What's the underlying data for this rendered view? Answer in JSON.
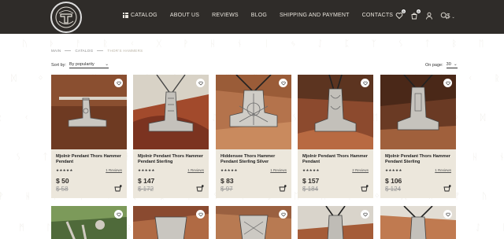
{
  "header": {
    "nav": [
      {
        "label": "CATALOG"
      },
      {
        "label": "ABOUT US"
      },
      {
        "label": "REVIEWS"
      },
      {
        "label": "BLOG"
      },
      {
        "label": "SHIPPING AND PAYMENT"
      },
      {
        "label": "CONTACTS"
      }
    ],
    "wishlist_count": "0",
    "cart_count": "0",
    "currency": "$",
    "icons": [
      "heart-icon",
      "shopping-bag-icon",
      "user-icon",
      "search-icon"
    ]
  },
  "breadcrumb": {
    "items": [
      "MAIN",
      "CATALOG",
      "THOR'S HAMMERS"
    ]
  },
  "sort": {
    "label": "Sort by:",
    "value": "By popularity"
  },
  "on_page": {
    "label": "On page:",
    "value": "30"
  },
  "products": [
    {
      "name": "Mjolnir Pendant Thors Hammer Pendant",
      "stars": "★★★★★",
      "reviews": "1 Reviews",
      "price": "$ 50",
      "old_price": "$ 58"
    },
    {
      "name": "Mjolnir Pendant Thors Hammer Pendant Sterling",
      "stars": "★★★★★",
      "reviews": "1 Reviews",
      "price": "$ 147",
      "old_price": "$ 172"
    },
    {
      "name": "Hiddensee Thors Hammer Pendant Sterling Silver",
      "stars": "★★★★★",
      "reviews": "1 Reviews",
      "price": "$ 83",
      "old_price": "$ 97"
    },
    {
      "name": "Mjolnir Pendant Thors Hammer Pendant",
      "stars": "★★★★★",
      "reviews": "2 Reviews",
      "price": "$ 157",
      "old_price": "$ 184"
    },
    {
      "name": "Mjolnir Pendant Thors Hammer Pendant Sterling",
      "stars": "★★★★★",
      "reviews": "1 Reviews",
      "price": "$ 106",
      "old_price": "$ 124"
    }
  ],
  "colors": {
    "header_bg": "#2f2c29",
    "card_bg": "#ece7dc",
    "price": "#2f2c29"
  }
}
